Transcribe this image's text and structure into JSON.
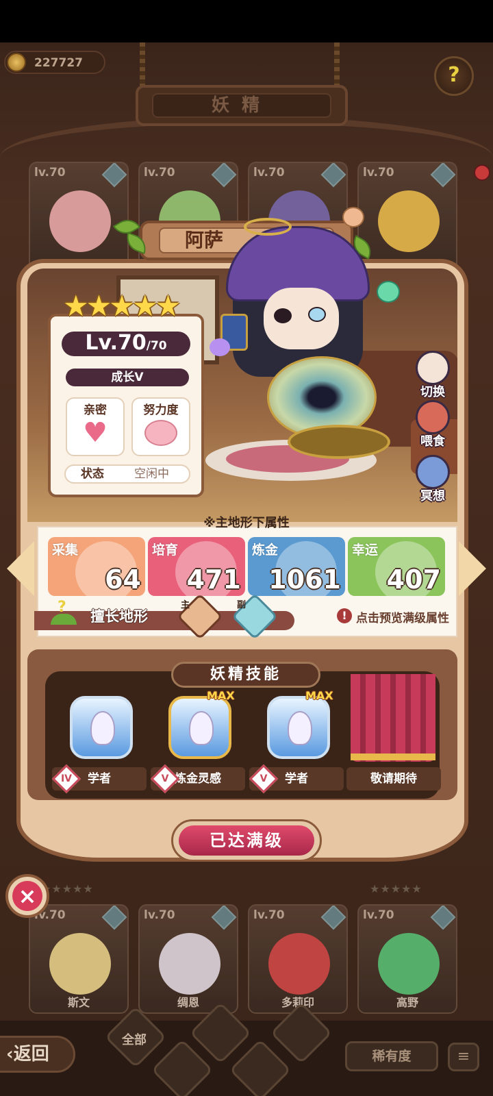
{
  "top": {
    "coins": "227727",
    "page_title": "妖精"
  },
  "background_cards_top": [
    {
      "level": "lv.70"
    },
    {
      "level": "lv.70"
    },
    {
      "level": "lv.70"
    },
    {
      "level": "lv.70"
    }
  ],
  "background_cards_bottom": [
    {
      "level": "lv.70",
      "name": "斯文"
    },
    {
      "level": "lv.70",
      "name": "绸恩"
    },
    {
      "level": "lv.70",
      "name": "多莉印"
    },
    {
      "level": "lv.70",
      "name": "高野"
    }
  ],
  "fairy": {
    "name": "阿萨",
    "stars": "★★★★★",
    "level": "Lv.70",
    "level_max": "/70",
    "growth": "成长V",
    "intimacy_label": "亲密",
    "effort_label": "努力度",
    "status_label": "状态",
    "status_value": "空闲中"
  },
  "side_actions": {
    "switch": "切换",
    "feed": "喂食",
    "meditate": "冥想"
  },
  "attributes": {
    "title": "※主地形下属性",
    "items": [
      {
        "label": "采集",
        "value": "64",
        "color": "#f4a478"
      },
      {
        "label": "培育",
        "value": "471",
        "color": "#e8607a"
      },
      {
        "label": "炼金",
        "value": "1061",
        "color": "#5a9ad0"
      },
      {
        "label": "幸运",
        "value": "407",
        "color": "#8ac45a"
      }
    ],
    "terrain_label": "擅长地形",
    "main_tag": "主",
    "sub_tag": "副",
    "hint": "点击预览满级属性"
  },
  "skills": {
    "title": "妖精技能",
    "items": [
      {
        "label": "学者",
        "grade": "IV",
        "max": ""
      },
      {
        "label": "炼金灵感",
        "grade": "V",
        "max": "MAX"
      },
      {
        "label": "学者",
        "grade": "V",
        "max": "MAX"
      },
      {
        "label": "敬请期待",
        "grade": "",
        "max": ""
      }
    ]
  },
  "max_level_button": "已达满级",
  "close_icon": "×",
  "nav": {
    "back": "返回",
    "filter_all": "全部",
    "sort": "稀有度",
    "list_icon": "≡"
  },
  "colors": {
    "accent": "#c83a5a",
    "panel": "#e7c7a3",
    "frame": "#8a5a3a"
  }
}
